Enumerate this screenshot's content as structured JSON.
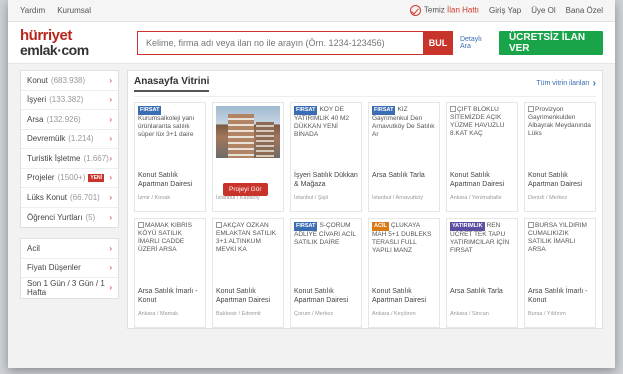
{
  "topbar": {
    "left": [
      "Yardım",
      "Kurumsal"
    ],
    "temiz": "Temiz",
    "ilan_hatti": "İlan Hattı",
    "giris": "Giriş Yap",
    "uye": "Üye Ol",
    "bana_ozel": "Bana Özel"
  },
  "logo": {
    "line1": "hürriyet",
    "line2": "emlak·com"
  },
  "search": {
    "placeholder": "Kelime, firma adı veya ilan no ile arayın (Örn. 1234-123456)",
    "button": "BUL",
    "detailed": "Detaylı Ara"
  },
  "cta": "ÜCRETSİZ İLAN VER",
  "sidebar": {
    "categories": [
      {
        "label": "Konut",
        "count": "(683.938)"
      },
      {
        "label": "İşyeri",
        "count": "(133.382)"
      },
      {
        "label": "Arsa",
        "count": "(132.926)"
      },
      {
        "label": "Devremülk",
        "count": "(1.214)"
      },
      {
        "label": "Turistik İşletme",
        "count": "(1.667)"
      },
      {
        "label": "Projeler",
        "count": "(1500+)",
        "badge": "YENİ"
      },
      {
        "label": "Lüks Konut",
        "count": "(66.701)"
      },
      {
        "label": "Öğrenci Yurtları",
        "count": "(5)"
      }
    ],
    "filters": [
      {
        "label": "Acil"
      },
      {
        "label": "Fiyatı Düşenler"
      },
      {
        "label": "Son 1 Gün / 3 Gün / 1 Hafta"
      }
    ]
  },
  "vitrin": {
    "title": "Anasayfa Vitrini",
    "all": "Tüm vitrin ilanları",
    "cards": [
      {
        "badge": "FIRSAT",
        "text": "Kurumsalkoleji yanı ürünlaranta satılık süper lüx 3+1 daire",
        "type": "Konut Satılık Apartman Dairesi",
        "loc": "İzmir / Konak"
      },
      {
        "photo": true,
        "button": "Projeyi Gör",
        "type": "",
        "loc": "İstanbul / Kadıköy"
      },
      {
        "badge": "FIRSAT",
        "text": "KÖY DE YATIRIMLIK 40 M2 DÜKKAN YENİ BİNADA",
        "type": "İşyeri Satılık Dükkan & Mağaza",
        "loc": "İstanbul / Şişli"
      },
      {
        "badge": "FIRSAT",
        "text": "KIZ Gayrimenkul Den Arnavutköy De Satılık Ar",
        "type": "Arsa Satılık Tarla",
        "loc": "İstanbul / Arnavutköy"
      },
      {
        "broken": true,
        "text": "ÇİFT BLOKLU SİTEMİZDE AÇIK YÜZME HAVUZLU 8.KAT KAÇ",
        "type": "Konut Satılık Apartman Dairesi",
        "loc": "Ankara / Yenimahalle"
      },
      {
        "broken": true,
        "text": "Provizyon Gayrimenkulden Albayrak Meydanında Lüks",
        "type": "Konut Satılık Apartman Dairesi",
        "loc": "Denizli / Merkez"
      },
      {
        "broken": true,
        "text": "MAMAK KIBRIS KÖYÜ SATILIK İMARLI CADDE ÜZERİ ARSA",
        "type": "Arsa Satılık İmarlı - Konut",
        "loc": "Ankara / Mamak"
      },
      {
        "broken": true,
        "text": "AKÇAY ÖZKAN EMLAKTAN SATILIK 3+1 ALTINKUM MEVKİ KA",
        "type": "Konut Satılık Apartman Dairesi",
        "loc": "Balıkesir / Edremit"
      },
      {
        "badge": "FIRSAT",
        "text": "S-ÇORUM ADLİYE CİVARI ACİL SATILIK DAİRE",
        "type": "Konut Satılık Apartman Dairesi",
        "loc": "Çorum / Merkez"
      },
      {
        "badge": "ACİL",
        "badgeClass": "acil",
        "text": "ÇLÜKAYA MAH 5+1 DUBLEKS TERASLI FULL YAPILI MANZ",
        "type": "Konut Satılık Apartman Dairesi",
        "loc": "Ankara / Keçiören"
      },
      {
        "badge": "YATIRIMLIK",
        "badgeClass": "yatirimlik",
        "text": "REN ÜCRET TEK TAPU YATIRIMCILAR İÇİN FIRSAT",
        "type": "Arsa Satılık Tarla",
        "loc": "Ankara / Sincan"
      },
      {
        "broken": true,
        "text": "BURSA YILDIRIM CUMALIKIZIK SATILIK İMARLI ARSA",
        "type": "Arsa Satılık İmarlı - Konut",
        "loc": "Bursa / Yıldırım"
      }
    ]
  },
  "colors": {
    "accent": "#c8332a",
    "cta": "#1aa44a",
    "link": "#3b6db3"
  }
}
